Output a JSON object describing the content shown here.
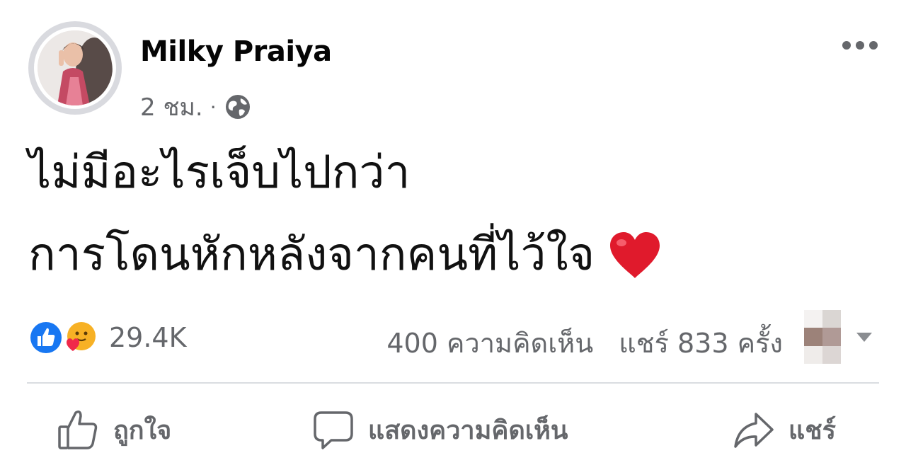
{
  "post": {
    "author": "Milky Praiya",
    "time": "2 ชม.",
    "separator": "·",
    "privacy_icon": "globe-icon",
    "more_icon": "more-dots-icon",
    "text_lines": [
      "ไม่มีอะไรเจ็บไปกว่า",
      "การโดนหักหลังจากคนที่ไว้ใจ"
    ],
    "emoji": "red-heart"
  },
  "reactions": {
    "icons": [
      "like-reaction-icon",
      "care-reaction-icon"
    ],
    "count": "29.4K",
    "comments": "400 ความคิดเห็น",
    "shares": "แชร์ 833 ครั้ง"
  },
  "actions": {
    "like_label": "ถูกใจ",
    "comment_label": "แสดงความคิดเห็น",
    "share_label": "แชร์"
  },
  "colors": {
    "like_blue": "#1877f2",
    "secondary_text": "#65676b",
    "divider": "#dadde1",
    "heart_red": "#e01a2c"
  }
}
